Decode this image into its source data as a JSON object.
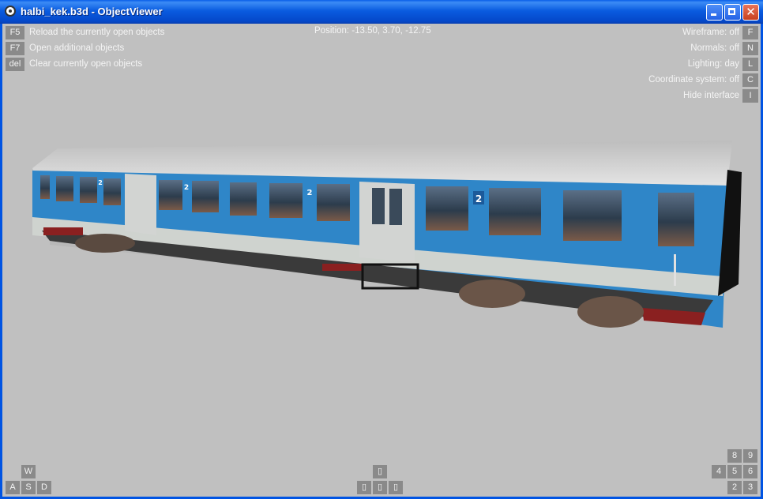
{
  "window": {
    "title": "halbi_kek.b3d - ObjectViewer"
  },
  "hud": {
    "left": [
      {
        "key": "F5",
        "label": "Reload the currently open objects"
      },
      {
        "key": "F7",
        "label": "Open additional objects"
      },
      {
        "key": "del",
        "label": "Clear currently open objects"
      }
    ],
    "position": "Position: -13.50, 3.70, -12.75",
    "right": [
      {
        "label": "Wireframe: off",
        "key": "F"
      },
      {
        "label": "Normals: off",
        "key": "N"
      },
      {
        "label": "Lighting: day",
        "key": "L"
      },
      {
        "label": "Coordinate system: off",
        "key": "C"
      },
      {
        "label": "Hide interface",
        "key": "I"
      }
    ],
    "move_keys": {
      "up": "W",
      "left": "A",
      "down": "S",
      "right": "D"
    },
    "arrow_keys": {
      "up": "▯",
      "left": "▯",
      "down": "▯",
      "right": "▯"
    },
    "numpad": {
      "n8": "8",
      "n9": "9",
      "n4": "4",
      "n5": "5",
      "n6": "6",
      "n2": "2",
      "n3": "3"
    }
  },
  "scene": {
    "coach_number_badge": "2"
  },
  "colors": {
    "viewport_bg": "#c0c0c0",
    "coach_blue": "#2f86c8",
    "roof": "#d8d8d8",
    "hud_key": "#8a8a8a"
  }
}
